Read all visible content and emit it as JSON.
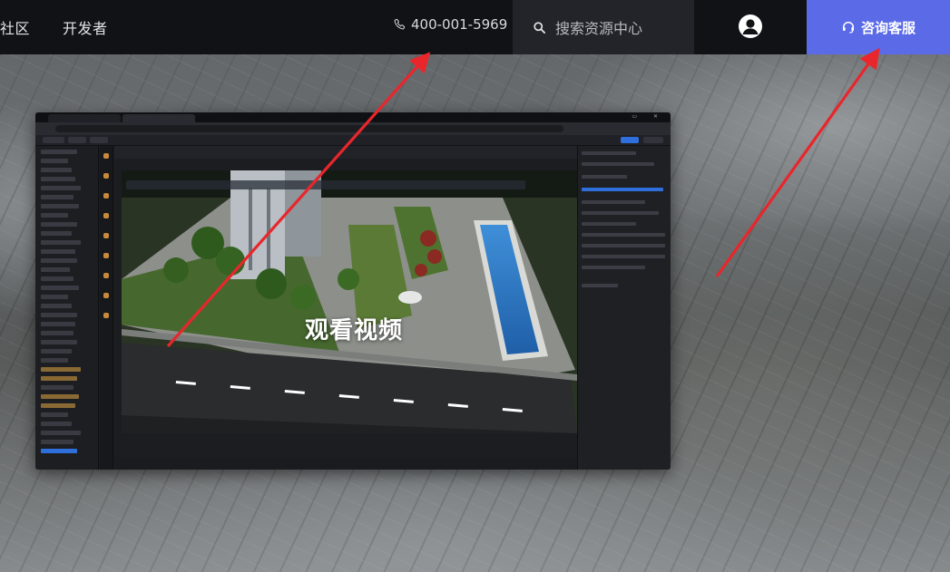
{
  "nav": {
    "community": "社区",
    "developer": "开发者",
    "phone": "400-001-5969",
    "search_placeholder": "搜索资源中心",
    "consult": "咨询客服"
  },
  "video": {
    "play_label": "观看视频"
  },
  "icons": {
    "phone": "phone-icon",
    "search": "search-icon",
    "user": "user-avatar-icon",
    "headset": "headset-icon"
  },
  "colors": {
    "nav_bg": "#111216",
    "search_bg": "#23242a",
    "consult_bg": "#5b6be8",
    "arrow": "#e8262c"
  }
}
